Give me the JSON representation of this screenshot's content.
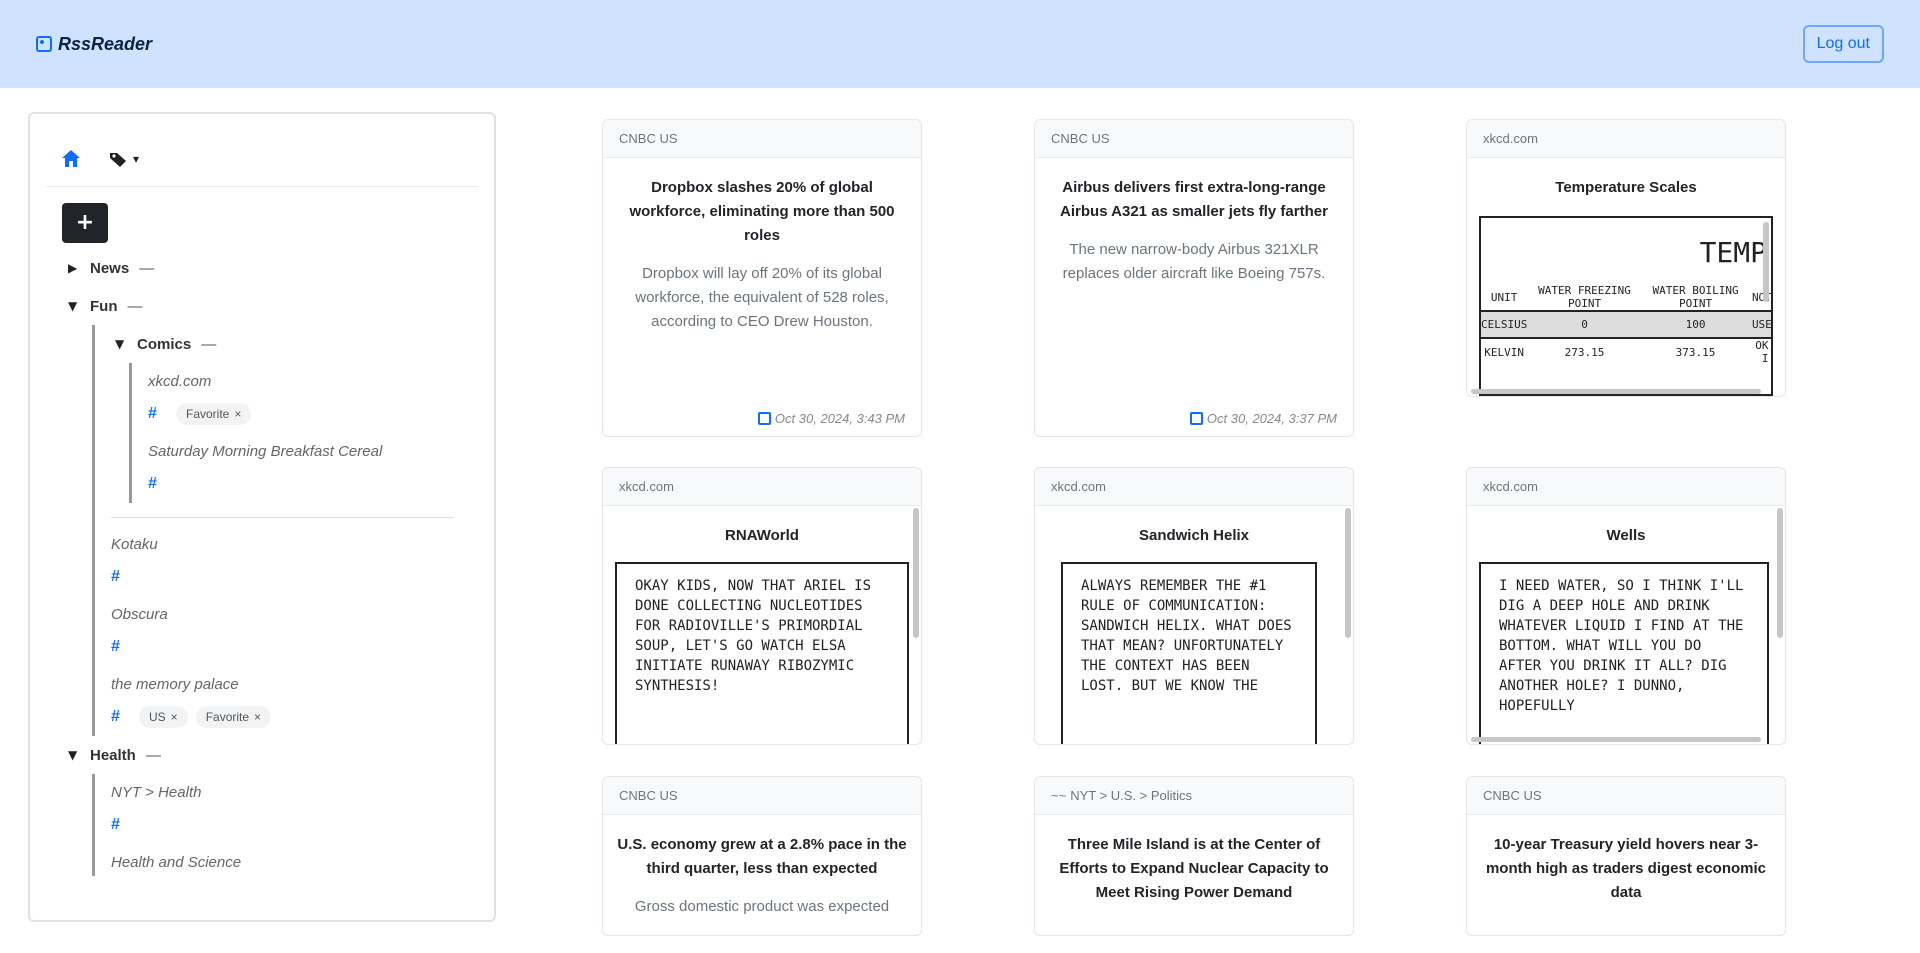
{
  "app": {
    "brand": "RssReader",
    "logout_label": "Log out"
  },
  "sidebar": {
    "add_label": "+",
    "folders": {
      "news": "News",
      "fun": "Fun",
      "comics": "Comics",
      "health": "Health",
      "collapse": "—"
    },
    "feeds": {
      "xkcd": {
        "name": "xkcd.com",
        "tags": [
          "Favorite"
        ]
      },
      "smbc": {
        "name": "Saturday Morning Breakfast Cereal"
      },
      "kotaku": {
        "name": "Kotaku"
      },
      "obscura": {
        "name": "Obscura"
      },
      "memory": {
        "name": "the memory palace",
        "tags": [
          "US",
          "Favorite"
        ]
      },
      "nyt_health": {
        "name": "NYT > Health"
      },
      "health_science": {
        "name": "Health and Science"
      }
    },
    "hash": "#",
    "chip_close": "×"
  },
  "cards": [
    {
      "source": "CNBC US",
      "title": "Dropbox slashes 20% of global workforce, eliminating more than 500 roles",
      "desc": "Dropbox will lay off 20% of its global workforce, the equivalent of 528 roles, according to CEO Drew Houston.",
      "date": "Oct 30, 2024, 3:43 PM"
    },
    {
      "source": "CNBC US",
      "title": "Airbus delivers first extra-long-range Airbus A321 as smaller jets fly farther",
      "desc": "The new narrow-body Airbus 321XLR replaces older aircraft like Boeing 757s.",
      "date": "Oct 30, 2024, 3:37 PM"
    },
    {
      "source": "xkcd.com",
      "title": "Temperature Scales",
      "comic": "TEMP"
    },
    {
      "source": "xkcd.com",
      "title": "RNAWorld",
      "comic": "Okay kids, now that Ariel is done collecting nucleotides for Radioville's primordial soup, let's go watch Elsa initiate runaway ribozymic synthesis!"
    },
    {
      "source": "xkcd.com",
      "title": "Sandwich Helix",
      "comic": "Always remember the #1 rule of communication: sandwich helix. What does that mean? Unfortunately the context has been lost. But we know the"
    },
    {
      "source": "xkcd.com",
      "title": "Wells",
      "comic": "I need water, so I think I'll dig a deep hole and drink whatever liquid I find at the bottom. What will you do after you drink it all? Dig another hole? I dunno, hopefully"
    },
    {
      "source": "CNBC US",
      "title": "U.S. economy grew at a 2.8% pace in the third quarter, less than expected",
      "desc": "Gross domestic product was expected"
    },
    {
      "source": "NYT > U.S. > Politics",
      "title": "Three Mile Island is at the Center of Efforts to Expand Nuclear Capacity to Meet Rising Power Demand"
    },
    {
      "source": "CNBC US",
      "title": "10-year Treasury yield hovers near 3-month high as traders digest economic data"
    }
  ],
  "temp_table": {
    "headers": [
      "UNIT",
      "WATER FREEZING POINT",
      "WATER BOILING POINT",
      "NOTE"
    ],
    "rows": [
      [
        "CELSIUS",
        "0",
        "100",
        "USED"
      ],
      [
        "KELVIN",
        "273.15",
        "373.15",
        "OK, I"
      ]
    ]
  },
  "colors": {
    "navbar": "#cfe2ff",
    "accent": "#0d6efd"
  }
}
